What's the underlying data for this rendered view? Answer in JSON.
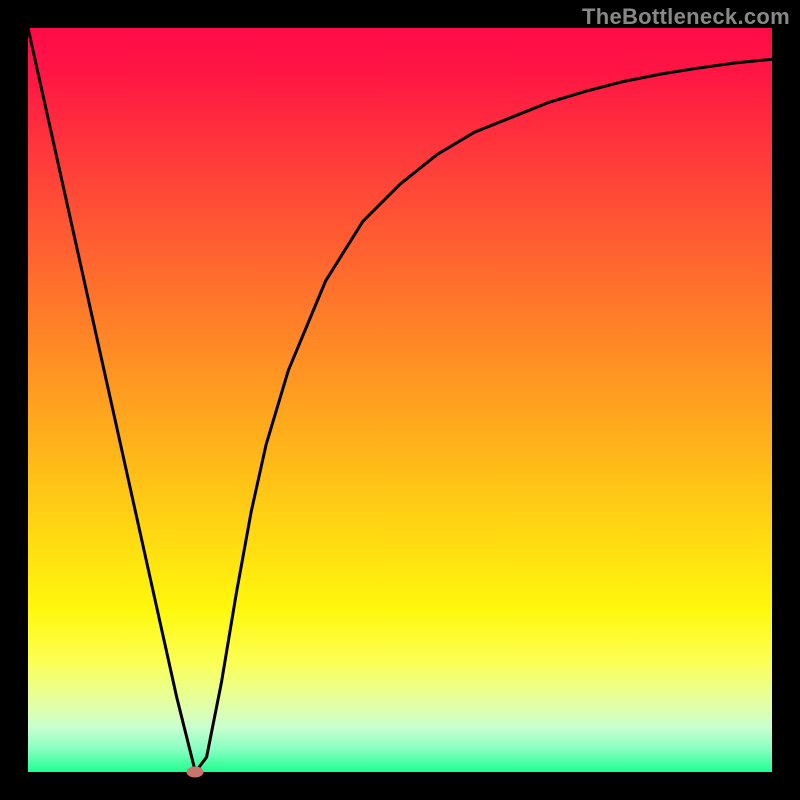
{
  "watermark": "TheBottleneck.com",
  "chart_data": {
    "type": "line",
    "title": "",
    "xlabel": "",
    "ylabel": "",
    "xlim": [
      0,
      100
    ],
    "ylim": [
      0,
      100
    ],
    "series": [
      {
        "name": "curve",
        "x": [
          0,
          4,
          8,
          12,
          16,
          20,
          22.5,
          24,
          26,
          28,
          30,
          32,
          35,
          40,
          45,
          50,
          55,
          60,
          65,
          70,
          75,
          80,
          85,
          90,
          95,
          100
        ],
        "y": [
          100,
          82,
          64,
          46,
          28,
          10,
          0,
          2,
          12,
          24,
          35,
          44,
          54,
          66,
          74,
          79,
          83,
          86,
          88,
          90,
          91.5,
          92.8,
          93.8,
          94.6,
          95.3,
          95.8
        ]
      }
    ],
    "marker": {
      "x": 22.5,
      "y": 0,
      "color": "#c9746e"
    },
    "gradient_stops": [
      {
        "pos": 0,
        "color": "#ff0b48"
      },
      {
        "pos": 24,
        "color": "#ff4f35"
      },
      {
        "pos": 42,
        "color": "#ff8726"
      },
      {
        "pos": 60,
        "color": "#ffbf17"
      },
      {
        "pos": 78,
        "color": "#fff80c"
      },
      {
        "pos": 91,
        "color": "#e3ffa6"
      },
      {
        "pos": 100,
        "color": "#1fff8f"
      }
    ]
  }
}
